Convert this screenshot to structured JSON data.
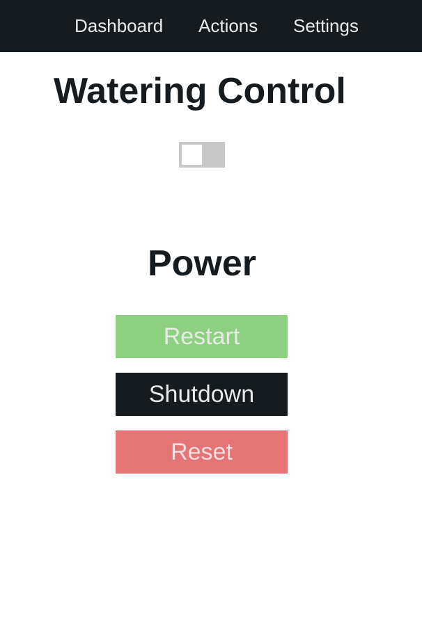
{
  "nav": {
    "items": [
      {
        "label": "Dashboard"
      },
      {
        "label": "Actions"
      },
      {
        "label": "Settings"
      }
    ]
  },
  "watering": {
    "title": "Watering Control",
    "toggle": {
      "on": false
    }
  },
  "power": {
    "title": "Power",
    "buttons": {
      "restart": "Restart",
      "shutdown": "Shutdown",
      "reset": "Reset"
    }
  },
  "colors": {
    "nav_bg": "#151b1f",
    "restart": "#8dd082",
    "shutdown": "#151b1f",
    "reset": "#e57574",
    "toggle_off": "#c8c8c8"
  }
}
